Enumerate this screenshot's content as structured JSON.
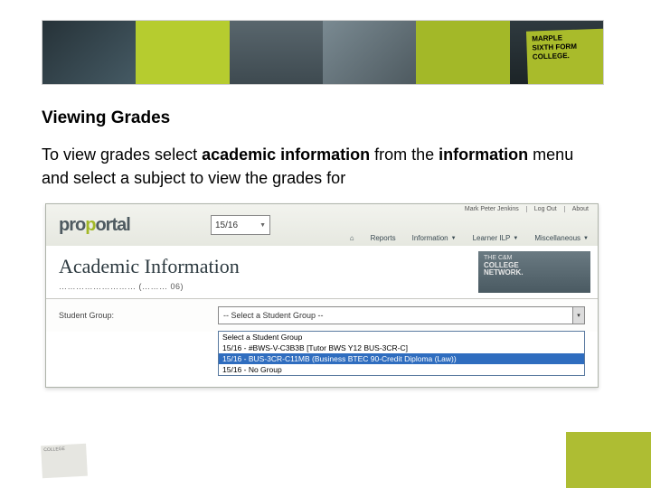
{
  "brand": {
    "line1": "MARPLE",
    "line2": "SIXTH FORM",
    "line3": "COLLEGE."
  },
  "heading": "Viewing Grades",
  "para": {
    "t1": "To view grades select ",
    "b1": "academic information",
    "t2": " from the ",
    "b2": "information",
    "t3": " menu and select a subject to view the grades for"
  },
  "screenshot": {
    "logo": {
      "p1": "pro",
      "p2": "p",
      "p3": "ortal"
    },
    "year": "15/16",
    "topright": {
      "user": "Mark Peter Jenkins",
      "logout": "Log Out",
      "about": "About"
    },
    "menu": {
      "home": "",
      "reports": "Reports",
      "information": "Information",
      "learner": "Learner ILP",
      "misc": "Miscellaneous"
    },
    "pageTitle": "Academic Information",
    "subline": "……………………… (………  06)",
    "network": {
      "l1": "THE C&M",
      "l2": "COLLEGE",
      "l3": "NETWORK."
    },
    "label": "Student Group:",
    "selected": "-- Select a Student Group --",
    "options": [
      "Select a Student Group",
      "15/16 - #BWS-V-C3B3B [Tutor BWS Y12 BUS-3CR-C]",
      "15/16 - BUS-3CR-C11MB (Business BTEC 90-Credit Diploma (Law))",
      "15/16 - No Group"
    ],
    "highlighted": 2
  },
  "footerLogo": "COLLEGE"
}
